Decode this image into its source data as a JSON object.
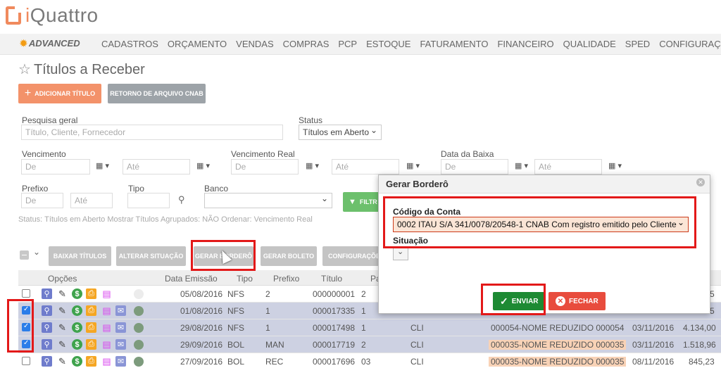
{
  "brand": {
    "logo_i": "i",
    "logo_rest": "Quattro",
    "accent": "#f08a5d"
  },
  "nav": {
    "advanced": "ADVANCED",
    "items": [
      "CADASTROS",
      "ORÇAMENTO",
      "VENDAS",
      "COMPRAS",
      "PCP",
      "ESTOQUE",
      "FATURAMENTO",
      "FINANCEIRO",
      "QUALIDADE",
      "SPED",
      "CONFIGURAÇÕES"
    ]
  },
  "page": {
    "title": "Títulos a Receber"
  },
  "actions": {
    "add": "ADICIONAR TÍTULO",
    "cnab": "RETORNO DE ARQUIVO CNAB"
  },
  "filters": {
    "pesquisa_label": "Pesquisa geral",
    "pesquisa_placeholder": "Título, Cliente, Fornecedor",
    "status_label": "Status",
    "status_value": "Títulos em Aberto",
    "vencimento_label": "Vencimento",
    "vencimento_real_label": "Vencimento Real",
    "data_baixa_label": "Data da Baixa",
    "de": "De",
    "ate": "Até",
    "prefixo_label": "Prefixo",
    "tipo_label": "Tipo",
    "banco_label": "Banco",
    "filter_button": "FILTR",
    "status_line": "Status: Títulos em Aberto   Mostrar Títulos Agrupados: NÃO   Ordenar: Vencimento Real"
  },
  "toolbar": {
    "baixar": "BAIXAR TÍTULOS",
    "alterar": "ALTERAR SITUAÇÃO",
    "gerar_bordero": "GERAR BORDERÔ",
    "gerar_boleto": "GERAR BOLETO",
    "configuracoes": "CONFIGURAÇÕE"
  },
  "table": {
    "headers": {
      "opcoes": "Opções",
      "emissao": "Data Emissão",
      "tipo": "Tipo",
      "prefixo": "Prefixo",
      "titulo": "Título",
      "parcela": "Pa"
    },
    "rows": [
      {
        "checked": false,
        "date": "05/08/2016",
        "tipo": "NFS",
        "prefixo": "2",
        "titulo": "000000001",
        "parcela": "2",
        "cli": "",
        "cliente": "",
        "venc": "",
        "valor": "5"
      },
      {
        "checked": true,
        "date": "01/08/2016",
        "tipo": "NFS",
        "prefixo": "1",
        "titulo": "000017335",
        "parcela": "1",
        "cli": "",
        "cliente": "",
        "venc": "",
        "valor": "5"
      },
      {
        "checked": true,
        "date": "29/08/2016",
        "tipo": "NFS",
        "prefixo": "1",
        "titulo": "000017498",
        "parcela": "1",
        "cli": "CLI",
        "cliente": "000054-NOME REDUZIDO 000054",
        "venc": "03/11/2016",
        "valor": "4.134,00"
      },
      {
        "checked": true,
        "date": "29/09/2016",
        "tipo": "BOL",
        "prefixo": "MAN",
        "titulo": "000017719",
        "parcela": "2",
        "cli": "CLI",
        "cliente": "000035-NOME REDUZIDO 000035",
        "venc": "03/11/2016",
        "valor": "1.518,96"
      },
      {
        "checked": false,
        "date": "27/09/2016",
        "tipo": "BOL",
        "prefixo": "REC",
        "titulo": "000017696",
        "parcela": "03",
        "cli": "CLI",
        "cliente": "000035-NOME REDUZIDO 000035",
        "venc": "08/11/2016",
        "valor": "845,23"
      }
    ]
  },
  "modal": {
    "title": "Gerar Borderô",
    "codigo_label": "Código da Conta",
    "codigo_value": "0002 ITAU S/A 341/0078/20548-1 CNAB Com registro emitido pelo Cliente",
    "situacao_label": "Situação",
    "send": "ENVIAR",
    "close": "FECHAR"
  }
}
